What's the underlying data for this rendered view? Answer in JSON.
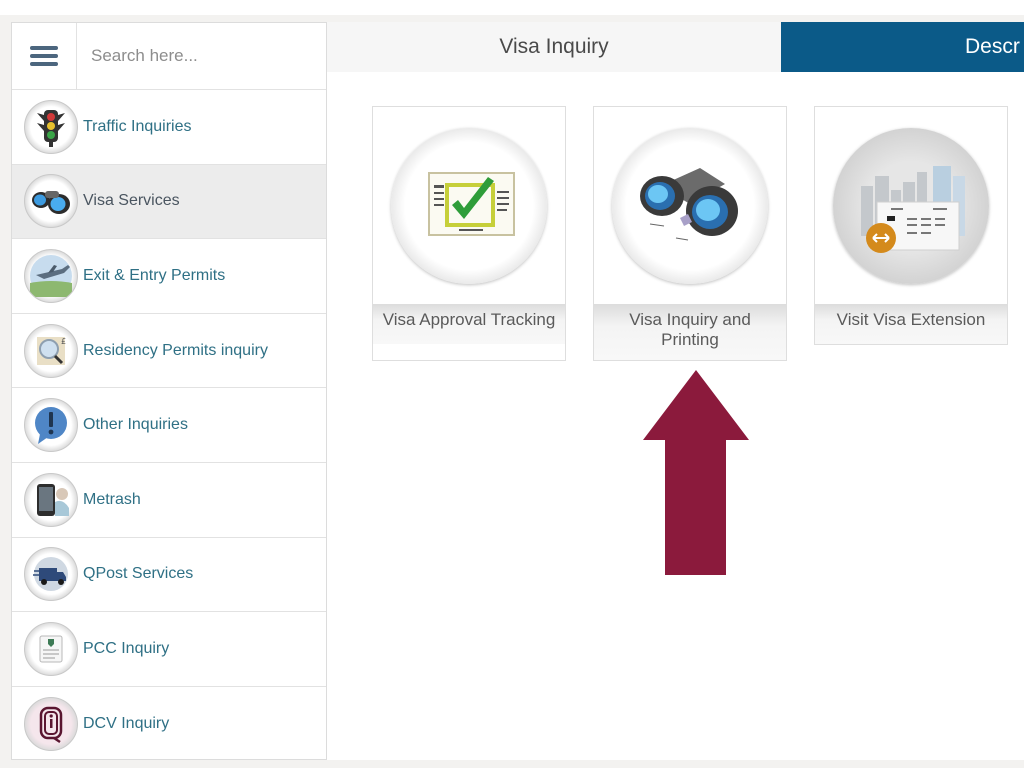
{
  "sidebar": {
    "search": {
      "placeholder": "Search here...",
      "value": ""
    },
    "items": [
      {
        "label": "Traffic Inquiries",
        "icon": "traffic-light-icon",
        "active": false
      },
      {
        "label": "Visa Services",
        "icon": "binoculars-icon",
        "active": true
      },
      {
        "label": "Exit & Entry Permits",
        "icon": "airplane-icon",
        "active": false
      },
      {
        "label": "Residency Permits inquiry",
        "icon": "magnifier-document-icon",
        "active": false
      },
      {
        "label": "Other Inquiries",
        "icon": "exclamation-bubble-icon",
        "active": false
      },
      {
        "label": "Metrash",
        "icon": "phone-app-icon",
        "active": false
      },
      {
        "label": "QPost Services",
        "icon": "delivery-van-icon",
        "active": false
      },
      {
        "label": "PCC Inquiry",
        "icon": "certificate-icon",
        "active": false
      },
      {
        "label": "DCV Inquiry",
        "icon": "id-card-icon",
        "active": false
      }
    ]
  },
  "main": {
    "tabs": [
      {
        "label": "Visa Inquiry",
        "active": false
      },
      {
        "label": "Descr",
        "active": true
      }
    ],
    "cards": [
      {
        "label": "Visa Approval Tracking",
        "icon": "approved-document-icon"
      },
      {
        "label": "Visa Inquiry and Printing",
        "icon": "binoculars-icon"
      },
      {
        "label": "Visit Visa Extension",
        "icon": "visa-extension-icon"
      }
    ]
  },
  "annotation": {
    "type": "arrow-up",
    "color": "#8b1a3c",
    "points_to": "Visa Inquiry and Printing"
  },
  "colors": {
    "tab_active": "#0b5a88",
    "nav_text": "#2f7085",
    "hamburger": "#4c667e"
  }
}
